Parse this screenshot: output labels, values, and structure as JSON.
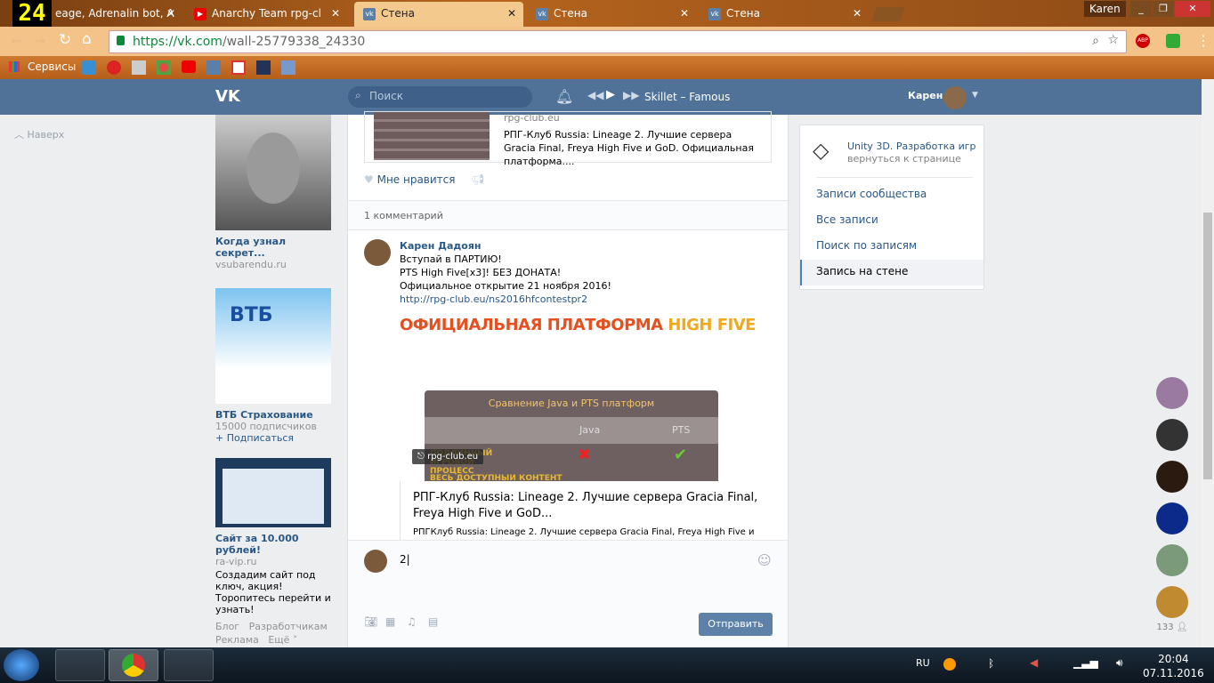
{
  "browser": {
    "tabs": [
      {
        "label": "eage, Adrenalin bot, A"
      },
      {
        "label": "Anarchy Team rpg-cl"
      },
      {
        "label": "Стена"
      },
      {
        "label": "Стена"
      },
      {
        "label": "Стена"
      }
    ],
    "user": "Karen",
    "url_host": "https://vk.com",
    "url_path": "/wall-25779338_24330",
    "bookmarks_label": "Сервисы",
    "clock_widget": "24"
  },
  "vk": {
    "search_placeholder": "Поиск",
    "now_playing": "Skillet – Famous",
    "username": "Карен",
    "back_to_top": "Наверх"
  },
  "ads": [
    {
      "title": "Когда узнал секрет...",
      "sub": "vsubarendu.ru"
    },
    {
      "title": "ВТБ Страхование",
      "sub": "15000 подписчиков",
      "action": "+ Подписаться",
      "logo": "ВТБ"
    },
    {
      "title": "Сайт за 10.000 рублей!",
      "sub": "ra-vip.ru",
      "text": "Создадим сайт под ключ, акция! Торопитесь перейти и узнать!"
    }
  ],
  "footer_links": [
    "Блог",
    "Разработчикам",
    "Реклама",
    "Ещё ˅"
  ],
  "post": {
    "link_domain": "rpg-club.eu",
    "link_desc": "РПГ-Клуб Russia: Lineage 2. Лучшие сервера Gracia Final, Freya High Five и GoD. Официальная платформа....",
    "like_label": "Мне нравится",
    "comments_count": "1 комментарий"
  },
  "comment": {
    "author": "Карен Дадоян",
    "lines": [
      "Вступай в ПАРТИЮ!",
      "PTS High Five[x3]! БЕЗ ДОНАТА!",
      "Официальное открытие 21 ноября 2016!"
    ],
    "link": "http://rpg-club.eu/ns2016hfcontestpr2",
    "banner_a": "ОФИЦИАЛЬНАЯ ПЛАТФОРМА ",
    "banner_b": "HIGH FIVE",
    "table_title": "Сравнение Java и PTS платформ",
    "col_java": "Java",
    "col_pts": "PTS",
    "row1": "ПОДЛИННЫЙ ИГРОВОЙ ПРОЦЕСС",
    "row2": "ВЕСЬ ДОСТУПНЫЙ КОНТЕНТ",
    "badge": "rpg-club.eu",
    "card_title": "РПГ-Клуб Russia: Lineage 2. Лучшие сервера Gracia Final, Freya High Five и GoD...",
    "card_desc": "РПГКлуб Russia: Lineage 2. Лучшие сервера Gracia Final, Freya High Five и"
  },
  "reply": {
    "value": "2",
    "send": "Отправить"
  },
  "group": {
    "name": "Unity 3D. Разработка игр",
    "back": "вернуться к странице"
  },
  "menu": [
    "Записи сообщества",
    "Все записи",
    "Поиск по записям",
    "Запись на стене"
  ],
  "friends_count": "133",
  "tray": {
    "lang": "RU",
    "time": "20:04",
    "date": "07.11.2016"
  }
}
